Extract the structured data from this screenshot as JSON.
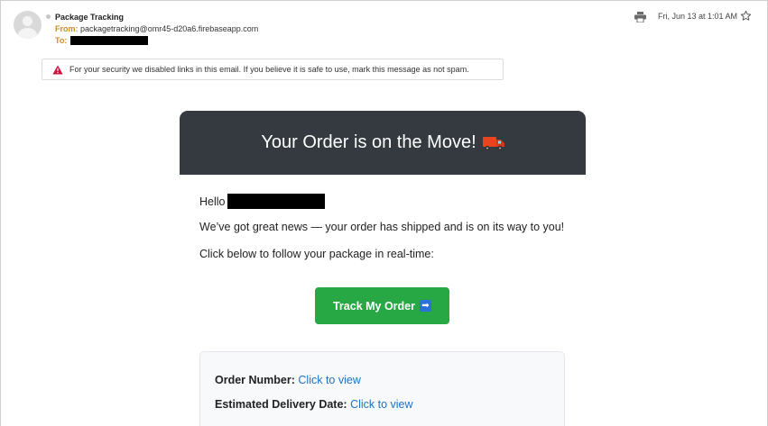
{
  "email": {
    "sender_name": "Package Tracking",
    "from_label": "From:",
    "from_address": "packagetracking@omr45-d20a6.firebaseapp.com",
    "to_label": "To:",
    "date": "Fri, Jun 13 at 1:01 AM"
  },
  "security_notice": {
    "text": "For your security we disabled links in this email. If you believe it is safe to use, mark this message as not spam."
  },
  "message": {
    "header_title": "Your Order is on the Move!",
    "greeting": "Hello",
    "line1": "We’ve got great news — your order has shipped and is on its way to you!",
    "line2": "Click below to follow your package in real-time:",
    "button_label": "Track My Order",
    "details": {
      "order_number_label": "Order Number:",
      "order_number_link": "Click to view",
      "delivery_label": "Estimated Delivery Date:",
      "delivery_link": "Click to view"
    }
  },
  "icons": {
    "avatar": "avatar-icon",
    "print": "print-icon",
    "star": "star-icon",
    "warning": "warning-icon",
    "truck": "truck-icon",
    "arrow": "right-arrow-icon"
  },
  "colors": {
    "header_bg": "#343a40",
    "button_bg": "#28a745",
    "link": "#1a73c9",
    "warning": "#d0103a",
    "meta_label": "#d48a2a"
  }
}
